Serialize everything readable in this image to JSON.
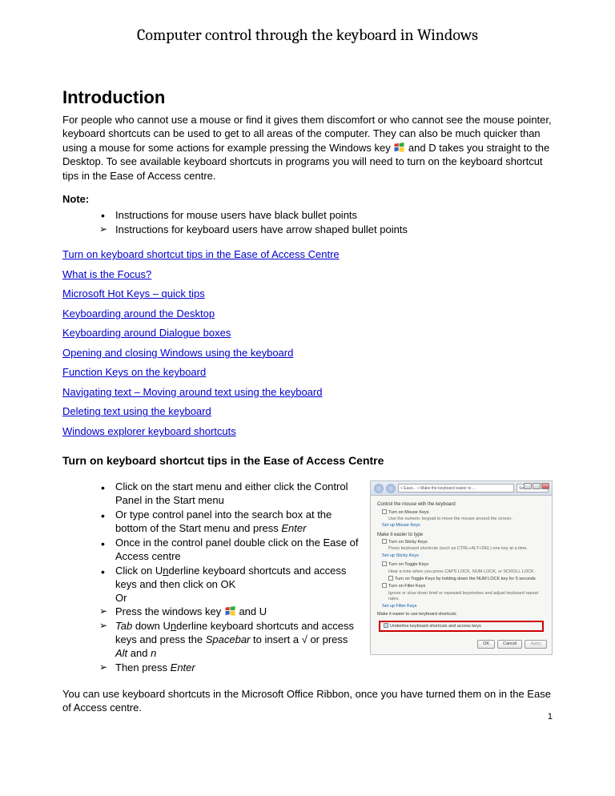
{
  "title": "Computer control through the keyboard in Windows",
  "intro_heading": "Introduction",
  "intro_text": "For people who cannot use a mouse or find it gives them discomfort or who cannot see the mouse pointer, keyboard shortcuts can be used to get to all areas of the computer. They can also be much quicker than using a mouse for some actions for example pressing the Windows key       and D takes you straight to the Desktop. To see available keyboard shortcuts in programs you will need to turn on the keyboard shortcut tips in the Ease of Access centre.",
  "note_label": "Note:",
  "note_items": [
    {
      "type": "disc",
      "text": "Instructions for mouse users have black bullet points"
    },
    {
      "type": "arrow",
      "text": "Instructions for keyboard users have arrow shaped bullet points"
    }
  ],
  "toc": [
    "Turn on keyboard shortcut tips in the Ease of Access Centre",
    "What is the Focus?",
    "Microsoft Hot Keys – quick tips",
    "Keyboarding around the Desktop",
    "Keyboarding around Dialogue boxes",
    "Opening and closing Windows using the keyboard",
    "Function Keys on the keyboard",
    "Navigating text – Moving around text using the keyboard",
    "Deleting text using the keyboard",
    "Windows explorer keyboard shortcuts"
  ],
  "section_heading": "Turn on keyboard shortcut tips in the Ease of Access Centre",
  "steps": [
    {
      "type": "disc",
      "html": "Click on the start menu and either click  the Control Panel in the Start menu"
    },
    {
      "type": "disc",
      "html": "Or type control panel into the search box at the bottom of the Start menu and press <em class='italic'>Enter</em>"
    },
    {
      "type": "disc",
      "html": "Once in the control panel double click on the Ease of Access centre"
    },
    {
      "type": "disc",
      "html": "Click on U<span class='ul'>n</span>derline  keyboard shortcuts and access keys and then click on OK"
    },
    {
      "type": "none",
      "html": "Or"
    },
    {
      "type": "arrow",
      "html": "Press the windows key       and U"
    },
    {
      "type": "arrow",
      "html": "<em class='italic'>Tab</em> down U<span class='ul'>n</span>derline  keyboard shortcuts and access keys and press the  <em class='italic'>Spacebar</em> to insert a √ or press <em class='italic'>Alt</em> and <em class='italic'>n</em>"
    },
    {
      "type": "arrow",
      "html": "Then press <em class='italic'>Enter</em>"
    }
  ],
  "closing": "You can use keyboard shortcuts in the Microsoft Office Ribbon, once you have turned them on in the Ease of Access centre.",
  "page_number": "1",
  "panel": {
    "breadcrumb": "« Ease... » Make the keyboard easier to ...",
    "search_hint": "Search Con...",
    "sec1_title": "Control the mouse with the keyboard",
    "sec1_row": "Turn on Mouse Keys",
    "sec1_sub": "Use the numeric keypad to move the mouse around the screen.",
    "sec1_link": "Set up Mouse Keys",
    "sec2_title": "Make it easier to type",
    "sec2_row1": "Turn on Sticky Keys",
    "sec2_sub1": "Press keyboard shortcuts (such as CTRL+ALT+DEL) one key at a time.",
    "sec2_link1": "Set up Sticky Keys",
    "sec2_row2": "Turn on Toggle Keys",
    "sec2_sub2": "Hear a tone when you press CAPS LOCK, NUM LOCK, or SCROLL LOCK.",
    "sec2_sub2b": "Turn on Toggle Keys by holding down the NUM LOCK key for 5 seconds",
    "sec2_row3": "Turn on Filter Keys",
    "sec2_sub3": "Ignore or slow down brief or repeated keystrokes and adjust keyboard repeat rates.",
    "sec2_link3": "Set up Filter Keys",
    "red_title": "Make it easier to use keyboard shortcuts",
    "red_row": "Underline keyboard shortcuts and access keys",
    "btn_ok": "OK",
    "btn_cancel": "Cancel",
    "btn_apply": "Apply"
  }
}
